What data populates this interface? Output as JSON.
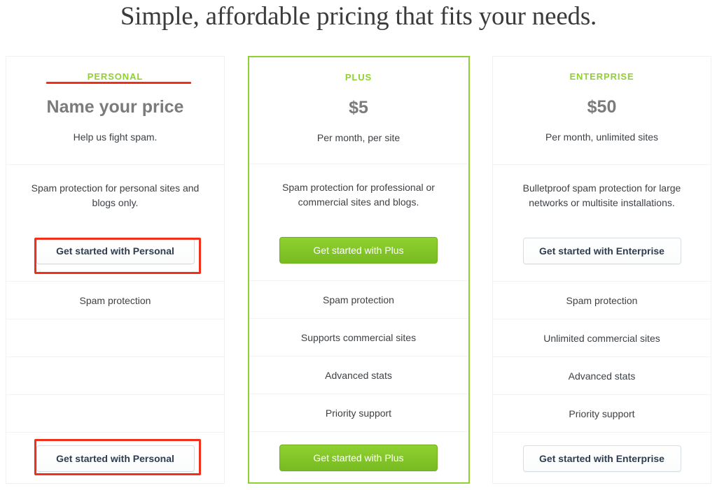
{
  "page": {
    "heading": "Simple, affordable pricing that fits your needs."
  },
  "colors": {
    "brand_green": "#8fd130",
    "annotation_red": "#f0301a",
    "price_grey": "#7b7b7b",
    "body_text": "#3d4145",
    "card_border": "#f0f1f2",
    "outline_button_border": "#d6dee3"
  },
  "plans": [
    {
      "id": "personal",
      "name": "PERSONAL",
      "price": "Name your price",
      "period": "Help us fight spam.",
      "description": "Spam protection for personal sites and blogs only.",
      "cta_label": "Get started with Personal",
      "cta_style": "outline",
      "featured": false,
      "features": [
        "Spam protection",
        "",
        "",
        ""
      ]
    },
    {
      "id": "plus",
      "name": "PLUS",
      "price": "$5",
      "period": "Per month, per site",
      "description": "Spam protection for professional or commercial sites and blogs.",
      "cta_label": "Get started with Plus",
      "cta_style": "primary",
      "featured": true,
      "features": [
        "Spam protection",
        "Supports commercial sites",
        "Advanced stats",
        "Priority support"
      ]
    },
    {
      "id": "enterprise",
      "name": "ENTERPRISE",
      "price": "$50",
      "period": "Per month, unlimited sites",
      "description": "Bulletproof spam protection for large networks or multisite installations.",
      "cta_label": "Get started with Enterprise",
      "cta_style": "outline",
      "featured": false,
      "features": [
        "Spam protection",
        "Unlimited commercial sites",
        "Advanced stats",
        "Priority support"
      ]
    }
  ]
}
